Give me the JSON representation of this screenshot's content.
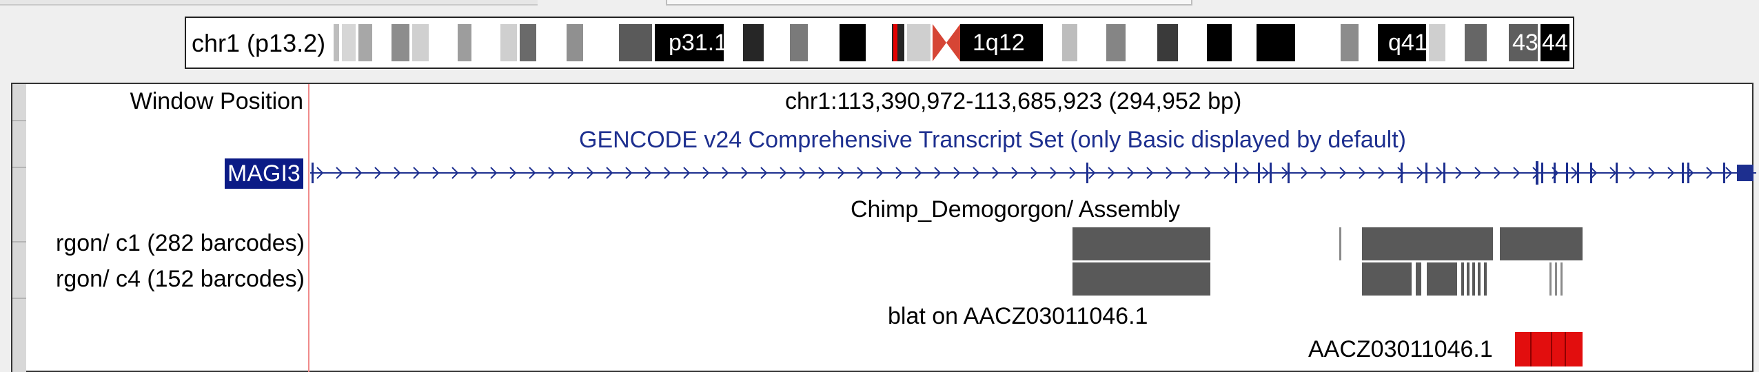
{
  "ideogram": {
    "label": "chr1 (p13.2)",
    "bands": [
      "p31.1",
      "1q12",
      "q41",
      "43",
      "44"
    ]
  },
  "tracks": {
    "window_position": {
      "label": "Window Position",
      "value": "chr1:113,390,972-113,685,923 (294,952 bp)"
    },
    "gencode": {
      "title": "GENCODE v24 Comprehensive Transcript Set (only Basic displayed by default)",
      "gene": "MAGI3"
    },
    "chimp": {
      "title": "Chimp_Demogorgon/ Assembly",
      "rows": [
        "rgon/ c1 (282 barcodes)",
        "rgon/ c4 (152 barcodes)"
      ]
    },
    "blat": {
      "title": "blat on AACZ03011046.1",
      "hit": "AACZ03011046.1"
    }
  },
  "colors": {
    "accent_blue": "#0b1b86",
    "track_blue": "#1d2f8f",
    "blat_red": "#e20e0e",
    "bar_gray": "#595959"
  }
}
